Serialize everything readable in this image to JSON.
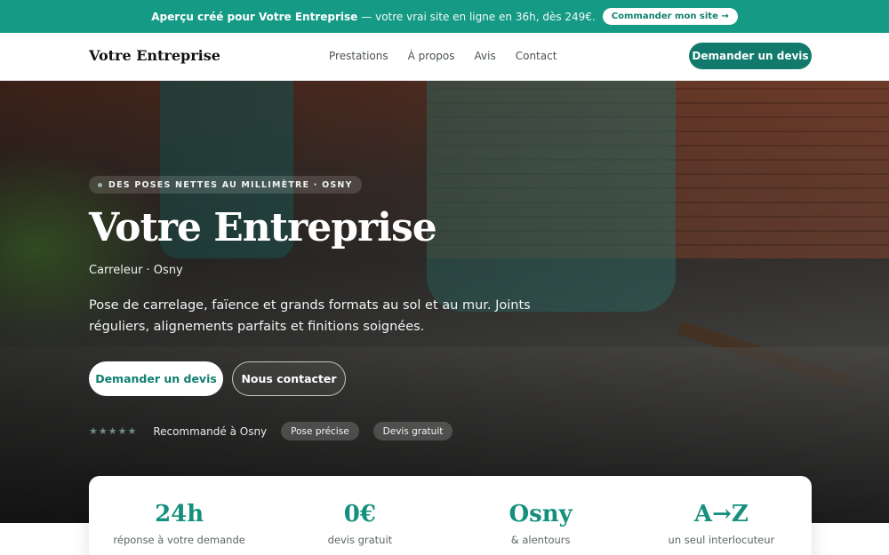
{
  "promo": {
    "strong": "Aperçu créé pour Votre Entreprise",
    "rest": "— votre vrai site en ligne en 36h, dès 249€.",
    "cta": "Commander mon site →"
  },
  "header": {
    "brand": "Votre Entreprise",
    "nav": [
      "Prestations",
      "À propos",
      "Avis",
      "Contact"
    ],
    "cta": "Demander un devis"
  },
  "hero": {
    "eyebrow": "DES POSES NETTES AU MILLIMÈTRE · OSNY",
    "title": "Votre Entreprise",
    "subtitle": "Carreleur · Osny",
    "description": "Pose de carrelage, faïence et grands formats au sol et au mur. Joints réguliers, alignements parfaits et finitions soignées.",
    "primary_button": "Demander un devis",
    "secondary_button": "Nous contacter",
    "stars": "★★★★★",
    "trust_text": "Recommandé à Osny",
    "chips": [
      "Pose précise",
      "Devis gratuit"
    ]
  },
  "stats": [
    {
      "value": "24h",
      "label": "réponse à votre demande"
    },
    {
      "value": "0€",
      "label": "devis gratuit"
    },
    {
      "value": "Osny",
      "label": "& alentours"
    },
    {
      "value": "A→Z",
      "label": "un seul interlocuteur"
    }
  ],
  "colors": {
    "accent": "#159a86",
    "accent_dark": "#117a6c"
  }
}
